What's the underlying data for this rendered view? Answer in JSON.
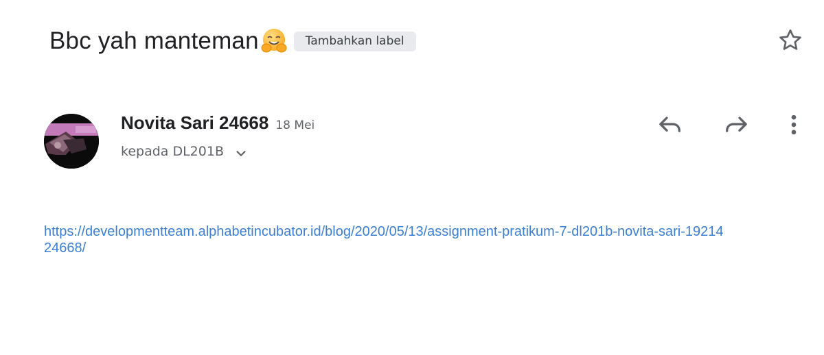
{
  "email": {
    "subject": "Bbc yah manteman",
    "subject_emoji": "smiling-hugging-face-emoji",
    "label_chip": "Tambahkan label",
    "star_icon": "star-outline-icon",
    "sender": {
      "name": "Novita Sari 24668",
      "date": "18 Mei",
      "recipient": "kepada DL201B"
    },
    "actions": {
      "reply_icon": "reply-icon",
      "forward_icon": "forward-icon",
      "more_icon": "more-vert-icon"
    },
    "body": {
      "link": "https://developmentteam.alphabetincubator.id/blog/2020/05/13/assignment-pratikum-7-dl201b-novita-sari-1921424668/"
    }
  },
  "colors": {
    "link": "#3b7fd4",
    "chip_bg": "#e8eaed",
    "icon": "#5f6368"
  }
}
